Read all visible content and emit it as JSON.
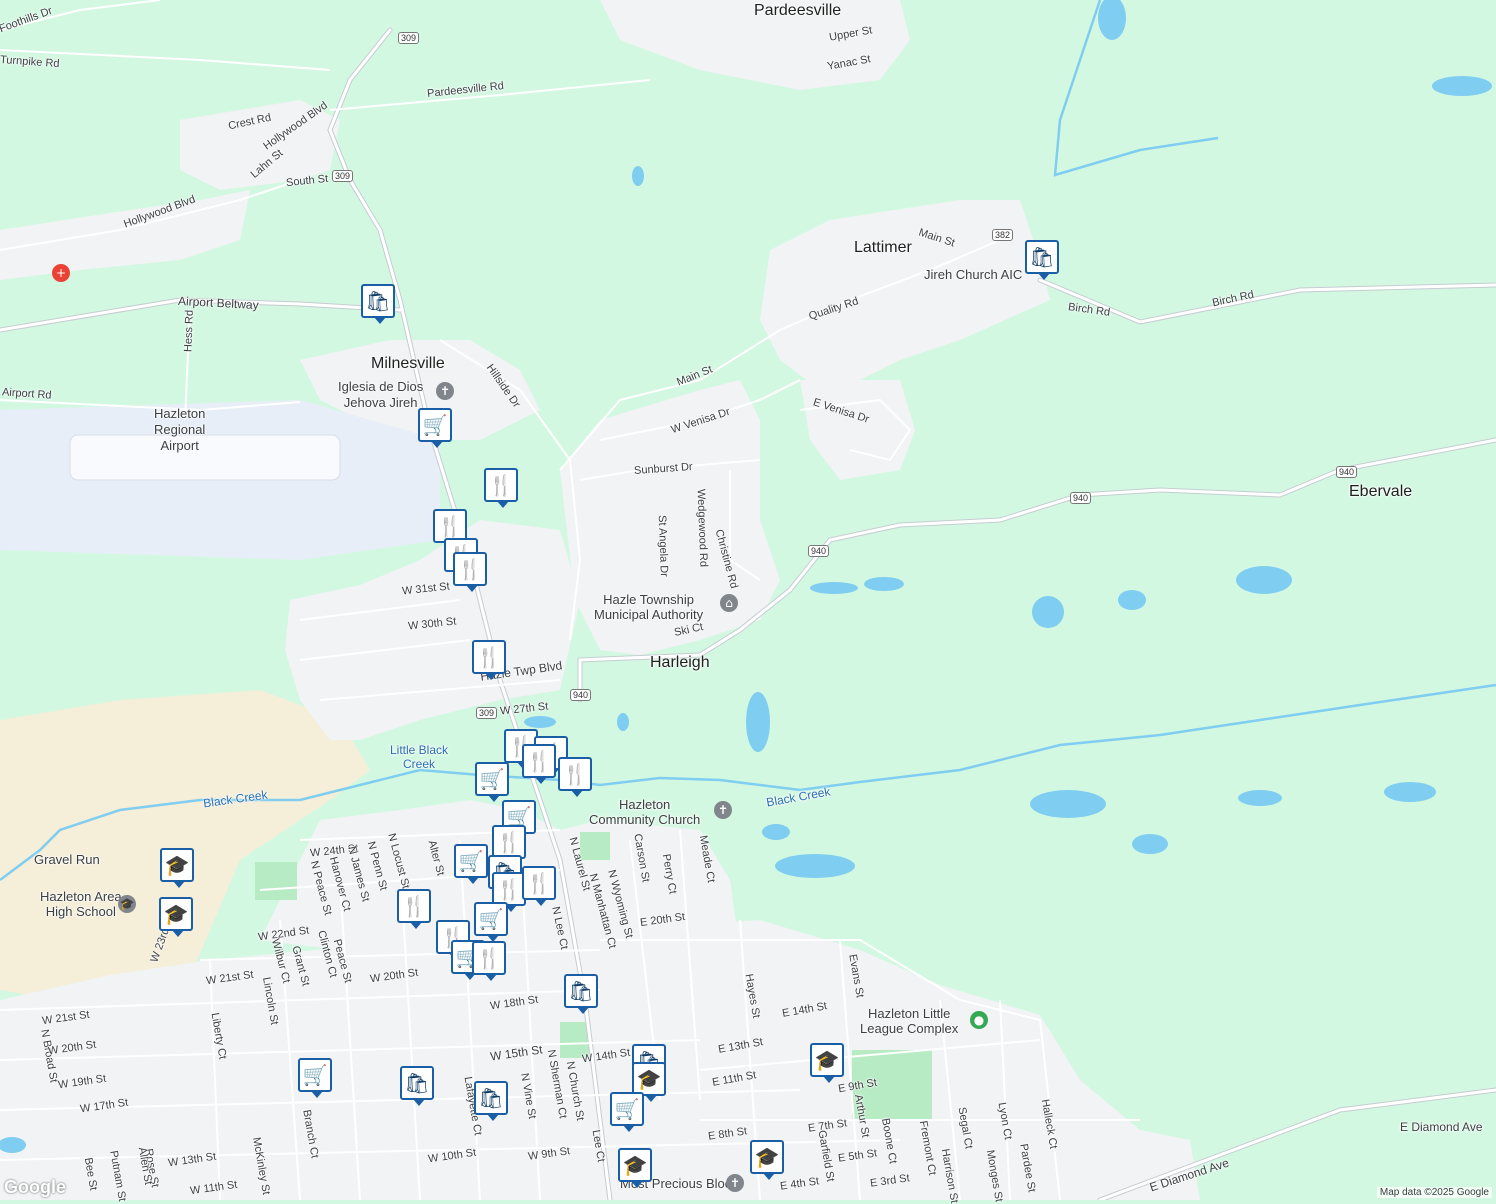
{
  "places": [
    {
      "id": "pardeesville",
      "text": "Pardeesville"
    },
    {
      "id": "lattimer",
      "text": "Lattimer"
    },
    {
      "id": "milnesville",
      "text": "Milnesville"
    },
    {
      "id": "harleigh",
      "text": "Harleigh"
    },
    {
      "id": "ebervale",
      "text": "Ebervale"
    }
  ],
  "pois": [
    {
      "id": "airport",
      "text": "Hazleton\nRegional\nAirport"
    },
    {
      "id": "iglesia",
      "text": "Iglesia de Dios\nJehova Jireh"
    },
    {
      "id": "jireh",
      "text": "Jireh Church AIC"
    },
    {
      "id": "hazle-muni",
      "text": "Hazle Township\nMunicipal Authority"
    },
    {
      "id": "hazleton-cc",
      "text": "Hazleton\nCommunity Church"
    },
    {
      "id": "hahs",
      "text": "Hazleton Area\nHigh School"
    },
    {
      "id": "little-league",
      "text": "Hazleton Little\nLeague Complex"
    },
    {
      "id": "most-precious",
      "text": "Most Precious Blood"
    },
    {
      "id": "gravel-run",
      "text": "Gravel Run"
    }
  ],
  "water": [
    {
      "id": "little-black-creek",
      "text": "Little Black\nCreek"
    },
    {
      "id": "black-creek-w",
      "text": "Black Creek"
    },
    {
      "id": "black-creek-e",
      "text": "Black Creek"
    }
  ],
  "streets": [
    "Foothills Dr",
    "Turnpike Rd",
    "Pardeesville Rd",
    "Upper St",
    "Yanac St",
    "Crest Rd",
    "Hollywood Blvd",
    "Lahn St",
    "South St",
    "Hollywood Blvd",
    "Airport Beltway",
    "Hess Rd",
    "Airport Rd",
    "Main St",
    "Quality Rd",
    "Birch Rd",
    "Birch Rd",
    "Hillside Dr",
    "Main St",
    "W Venisa Dr",
    "E Venisa Dr",
    "Sunburst Dr",
    "Wedgewood Rd",
    "St Angela Dr",
    "Christine Rd",
    "Ski Ct",
    "W 31st St",
    "W 30th St",
    "Hazle Twp Blvd",
    "W 27th St",
    "W 24th St",
    "N Locust St",
    "N Penn St",
    "N James St",
    "Hanover Ct",
    "N Peace St",
    "Alter St",
    "N Laurel St",
    "N Manhattan Ct",
    "N Wyoming St",
    "Carson St",
    "Perry Ct",
    "Meade Ct",
    "E 20th St",
    "W 22nd St",
    "Grant St",
    "Clinton Ct",
    "Peace St",
    "Wilbur Ct",
    "Lincoln St",
    "Branch Ct",
    "W 20th St",
    "W 21st St",
    "Liberty Ct",
    "N Broad St",
    "W 18th St",
    "W 15th St",
    "W 14th St",
    "E 14th St",
    "E 13th St",
    "E 11th St",
    "Evans St",
    "Hayes St",
    "E 9th St",
    "Arthur St",
    "Boone Ct",
    "Segal Ct",
    "Lyon Ct",
    "Halleck Ct",
    "E Diamond Ave",
    "E Diamond Ave",
    "N Church St",
    "N Sherman Ct",
    "N Vine St",
    "Lafayette Ct",
    "W 10th St",
    "W 9th St",
    "E 8th St",
    "E 7th St",
    "E 5th St",
    "E 3rd St",
    "Garfield St",
    "Fremont Ct",
    "Harrison St",
    "Monges St",
    "Pardee St",
    "W 13th St",
    "W 11th St",
    "McKinley St",
    "Rose St",
    "Allen St",
    "Putnam St",
    "Bee St",
    "W 17th St",
    "W 19th St",
    "W 20th St",
    "W 23rd St",
    "N Lee Ct",
    "W 21st St",
    "Lee Ct",
    "E 4th St"
  ],
  "shields": [
    "309",
    "309",
    "382",
    "940",
    "940",
    "940",
    "940",
    "309"
  ],
  "markers": [
    {
      "type": "shopping",
      "glyph": "🛍"
    },
    {
      "type": "shopping",
      "glyph": "🛍"
    },
    {
      "type": "grocery",
      "glyph": "🛒"
    },
    {
      "type": "restaurant",
      "glyph": "🍴"
    },
    {
      "type": "restaurant",
      "glyph": "🍴"
    },
    {
      "type": "restaurant",
      "glyph": "🍴"
    },
    {
      "type": "restaurant",
      "glyph": "🍴"
    },
    {
      "type": "restaurant",
      "glyph": "🍴"
    },
    {
      "type": "restaurant",
      "glyph": "🍴"
    },
    {
      "type": "restaurant",
      "glyph": "🍴"
    },
    {
      "type": "restaurant",
      "glyph": "🍴"
    },
    {
      "type": "grocery",
      "glyph": "🛒"
    },
    {
      "type": "restaurant",
      "glyph": "🍴"
    },
    {
      "type": "grocery",
      "glyph": "🛒"
    },
    {
      "type": "restaurant",
      "glyph": "🍴"
    },
    {
      "type": "grocery",
      "glyph": "🛒"
    },
    {
      "type": "shopping",
      "glyph": "🛍"
    },
    {
      "type": "restaurant",
      "glyph": "🍴"
    },
    {
      "type": "restaurant",
      "glyph": "🍴"
    },
    {
      "type": "restaurant",
      "glyph": "🍴"
    },
    {
      "type": "grocery",
      "glyph": "🛒"
    },
    {
      "type": "restaurant",
      "glyph": "🍴"
    },
    {
      "type": "grocery",
      "glyph": "🛒"
    },
    {
      "type": "restaurant",
      "glyph": "🍴"
    },
    {
      "type": "school",
      "glyph": "🎓"
    },
    {
      "type": "school",
      "glyph": "🎓"
    },
    {
      "type": "shopping",
      "glyph": "🛍"
    },
    {
      "type": "grocery",
      "glyph": "🛒"
    },
    {
      "type": "shopping",
      "glyph": "🛍"
    },
    {
      "type": "shopping",
      "glyph": "🛍"
    },
    {
      "type": "shopping",
      "glyph": "🛍"
    },
    {
      "type": "school",
      "glyph": "🎓"
    },
    {
      "type": "grocery",
      "glyph": "🛒"
    },
    {
      "type": "school",
      "glyph": "🎓"
    },
    {
      "type": "school",
      "glyph": "🎓"
    },
    {
      "type": "school",
      "glyph": "🎓"
    }
  ],
  "footer": {
    "attribution": "Map data ©2025 Google",
    "logo": "Google"
  },
  "colors": {
    "land": "#d3f8e2",
    "urban": "#f1f3f4",
    "water": "#7fcdf0",
    "road": "#ffffff",
    "roadEdge": "#c6ccd3",
    "airport": "#e8eef7",
    "sand": "#f5eed8",
    "park": "#b7ebc4"
  }
}
